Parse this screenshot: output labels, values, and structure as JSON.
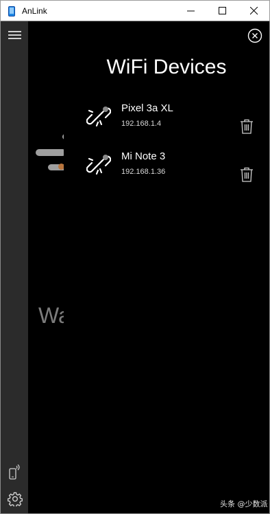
{
  "window": {
    "title": "AnLink"
  },
  "background_page": {
    "status_text": "Wa"
  },
  "panel": {
    "title": "WiFi Devices",
    "devices": [
      {
        "name": "Pixel 3a XL",
        "ip": "192.168.1.4"
      },
      {
        "name": "Mi Note 3",
        "ip": "192.168.1.36"
      }
    ]
  },
  "watermark": "头条 @少数派",
  "colors": {
    "rail": "#2b2b2b",
    "background": "#000000",
    "accent_knob": "#b8753d"
  }
}
